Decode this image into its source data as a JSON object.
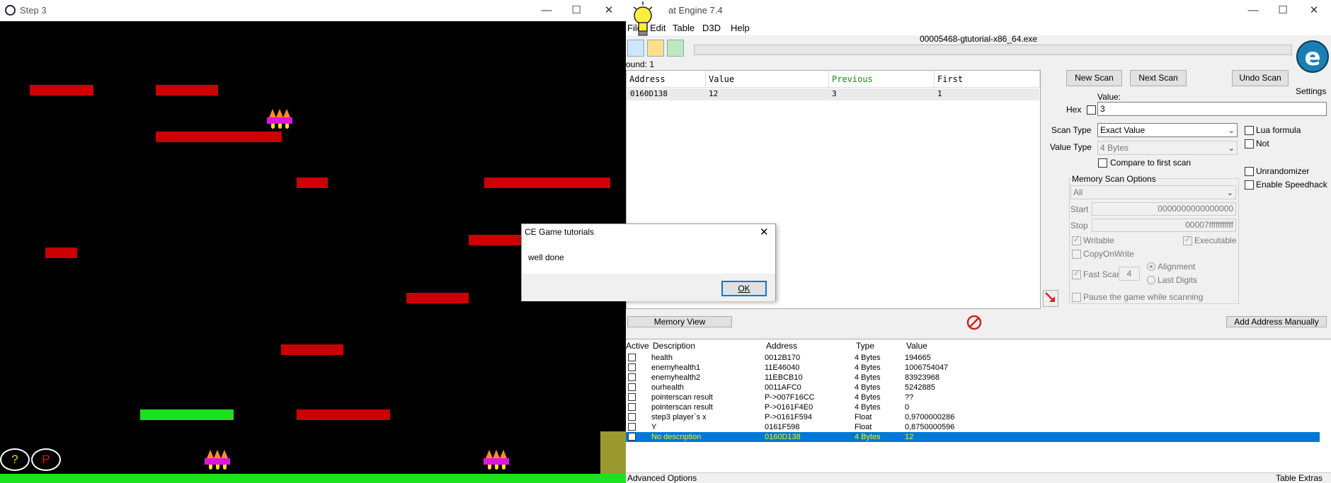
{
  "game_window": {
    "title": "Step 3",
    "help_button": "?",
    "pause_button": "P"
  },
  "ce_window": {
    "title": "at Engine 7.4",
    "menu": [
      "File",
      "Edit",
      "Table",
      "D3D",
      "Help"
    ],
    "process_name": "00005468-gtutorial-x86_64.exe",
    "found_label": "ound: 1",
    "settings_label": "Settings",
    "results": {
      "headers": [
        "Address",
        "Value",
        "Previous",
        "First"
      ],
      "row": [
        "0160D138",
        "12",
        "3",
        "1"
      ]
    },
    "scan": {
      "new_scan": "New Scan",
      "next_scan": "Next Scan",
      "undo_scan": "Undo Scan",
      "value_label": "Value:",
      "hex_label": "Hex",
      "value": "3",
      "scan_type_label": "Scan Type",
      "scan_type_value": "Exact Value",
      "value_type_label": "Value Type",
      "value_type_value": "4 Bytes",
      "compare_first": "Compare to first scan",
      "lua_formula": "Lua formula",
      "not_label": "Not",
      "unrandomizer": "Unrandomizer",
      "enable_speedhack": "Enable Speedhack",
      "memory_scan_options": "Memory Scan Options",
      "region": "All",
      "start_label": "Start",
      "start_value": "0000000000000000",
      "stop_label": "Stop",
      "stop_value": "00007fffffffffff",
      "writable": "Writable",
      "executable": "Executable",
      "copy_on_write": "CopyOnWrite",
      "fast_scan": "Fast Scan",
      "fast_scan_value": "4",
      "alignment": "Alignment",
      "last_digits": "Last Digits",
      "pause_game": "Pause the game while scanning"
    },
    "memory_view": "Memory View",
    "add_address": "Add Address Manually",
    "address_list": {
      "headers": [
        "Active",
        "Description",
        "Address",
        "Type",
        "Value"
      ],
      "rows": [
        {
          "desc": "health",
          "address": "0012B170",
          "type": "4 Bytes",
          "value": "194665"
        },
        {
          "desc": "enemyhealth1",
          "address": "11E46040",
          "type": "4 Bytes",
          "value": "1006754047"
        },
        {
          "desc": "enemyhealth2",
          "address": "11EBCB10",
          "type": "4 Bytes",
          "value": "83923968"
        },
        {
          "desc": "ourhealth",
          "address": "0011AFC0",
          "type": "4 Bytes",
          "value": "5242885"
        },
        {
          "desc": "pointerscan result",
          "address": "P->007F16CC",
          "type": "4 Bytes",
          "value": "??"
        },
        {
          "desc": "pointerscan result",
          "address": "P->0161F4E0",
          "type": "4 Bytes",
          "value": "0"
        },
        {
          "desc": "step3 player`s x",
          "address": "P->0161F594",
          "type": "Float",
          "value": "0,9700000286"
        },
        {
          "desc": "Y",
          "address": "0161F598",
          "type": "Float",
          "value": "0,8750000596"
        },
        {
          "desc": "No description",
          "address": "0160D138",
          "type": "4 Bytes",
          "value": "12"
        }
      ]
    },
    "advanced_options": "Advanced Options",
    "table_extras": "Table Extras"
  },
  "dialog": {
    "title": "CE Game tutorials",
    "message": "well done",
    "ok": "OK"
  }
}
